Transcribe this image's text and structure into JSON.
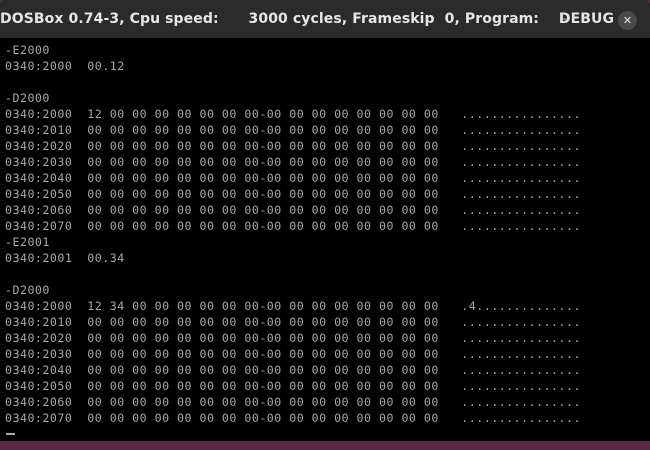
{
  "window": {
    "title": "DOSBox 0.74-3, Cpu speed:      3000 cycles, Frameskip  0, Program:    DEBUG",
    "minimize_glyph": "–",
    "close_glyph": "✕"
  },
  "terminal": {
    "lines": [
      "-E2000",
      "0340:2000  00.12",
      "",
      "-D2000",
      "0340:2000  12 00 00 00 00 00 00 00-00 00 00 00 00 00 00 00   ................",
      "0340:2010  00 00 00 00 00 00 00 00-00 00 00 00 00 00 00 00   ................",
      "0340:2020  00 00 00 00 00 00 00 00-00 00 00 00 00 00 00 00   ................",
      "0340:2030  00 00 00 00 00 00 00 00-00 00 00 00 00 00 00 00   ................",
      "0340:2040  00 00 00 00 00 00 00 00-00 00 00 00 00 00 00 00   ................",
      "0340:2050  00 00 00 00 00 00 00 00-00 00 00 00 00 00 00 00   ................",
      "0340:2060  00 00 00 00 00 00 00 00-00 00 00 00 00 00 00 00   ................",
      "0340:2070  00 00 00 00 00 00 00 00-00 00 00 00 00 00 00 00   ................",
      "-E2001",
      "0340:2001  00.34",
      "",
      "-D2000",
      "0340:2000  12 34 00 00 00 00 00 00-00 00 00 00 00 00 00 00   .4..............",
      "0340:2010  00 00 00 00 00 00 00 00-00 00 00 00 00 00 00 00   ................",
      "0340:2020  00 00 00 00 00 00 00 00-00 00 00 00 00 00 00 00   ................",
      "0340:2030  00 00 00 00 00 00 00 00-00 00 00 00 00 00 00 00   ................",
      "0340:2040  00 00 00 00 00 00 00 00-00 00 00 00 00 00 00 00   ................",
      "0340:2050  00 00 00 00 00 00 00 00-00 00 00 00 00 00 00 00   ................",
      "0340:2060  00 00 00 00 00 00 00 00-00 00 00 00 00 00 00 00   ................",
      "0340:2070  00 00 00 00 00 00 00 00-00 00 00 00 00 00 00 00   ................"
    ]
  },
  "colors": {
    "terminal_text": "#a8a8a8",
    "terminal_background": "#000000",
    "titlebar_background": "#2b2b2b"
  }
}
